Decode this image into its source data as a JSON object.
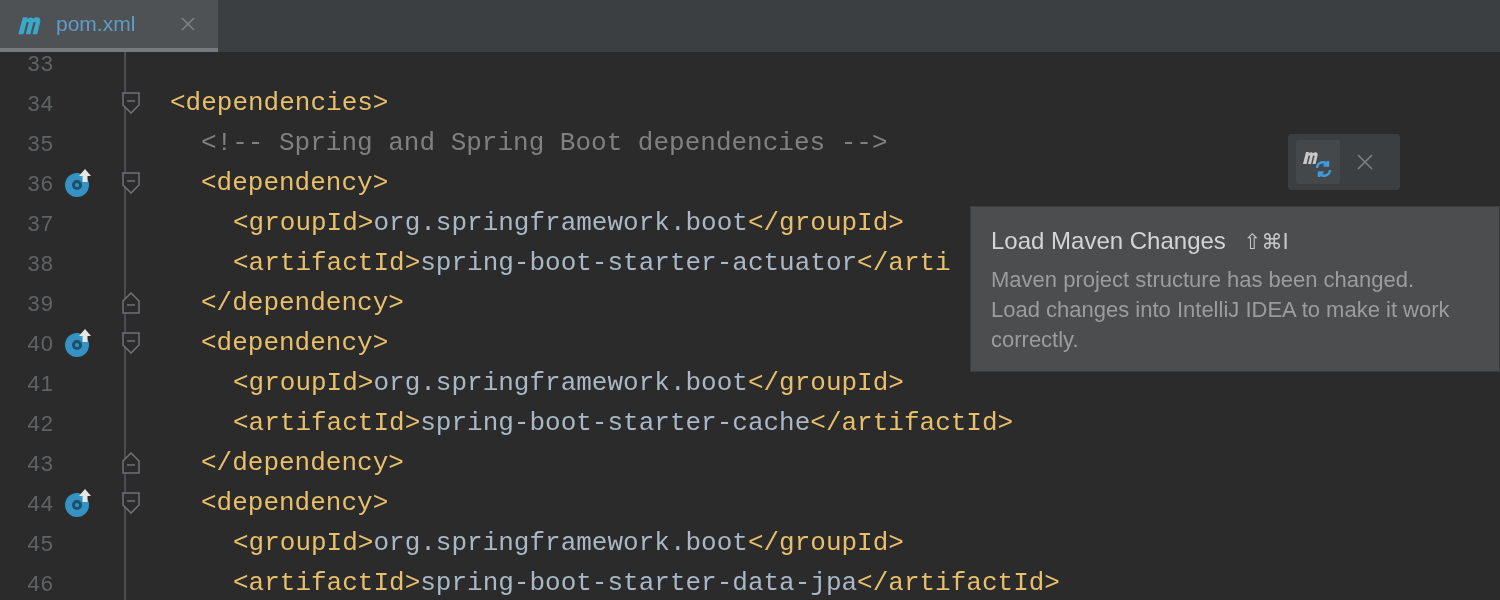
{
  "tab": {
    "title": "pom.xml",
    "selected": true
  },
  "lines": [
    {
      "number": "33",
      "gutter_icon": false
    },
    {
      "number": "34",
      "kind": "fold_start",
      "tokens": [
        {
          "kind": "tag",
          "text": "<dependencies>"
        }
      ],
      "gutter_icon": false,
      "children": [
        {
          "number": "35",
          "tokens": [
            {
              "kind": "comment",
              "text": "<!-- Spring and Spring Boot dependencies -->"
            }
          ],
          "gutter_icon": false
        },
        {
          "number": "36",
          "kind": "fold_start",
          "tokens": [
            {
              "kind": "tag",
              "text": "<dependency>"
            }
          ],
          "gutter_icon": true,
          "children": [
            {
              "number": "37",
              "tokens": [
                {
                  "kind": "tag",
                  "text": "<groupId>"
                },
                {
                  "kind": "text",
                  "text": "org.springframework.boot"
                },
                {
                  "kind": "tag",
                  "text": "</groupId>"
                }
              ],
              "gutter_icon": false
            },
            {
              "number": "38",
              "tokens": [
                {
                  "kind": "tag",
                  "text": "<artifactId>"
                },
                {
                  "kind": "text",
                  "text": "spring-boot-starter-actuator"
                },
                {
                  "kind": "tag",
                  "text": "</arti"
                }
              ],
              "gutter_icon": false
            }
          ]
        },
        {
          "number": "39",
          "kind": "fold_end",
          "tokens": [
            {
              "kind": "tag",
              "text": "</dependency>"
            }
          ],
          "gutter_icon": false
        },
        {
          "number": "40",
          "kind": "fold_start",
          "tokens": [
            {
              "kind": "tag",
              "text": "<dependency>"
            }
          ],
          "gutter_icon": true,
          "children": [
            {
              "number": "41",
              "tokens": [
                {
                  "kind": "tag",
                  "text": "<groupId>"
                },
                {
                  "kind": "text",
                  "text": "org.springframework.boot"
                },
                {
                  "kind": "tag",
                  "text": "</groupId>"
                }
              ],
              "gutter_icon": false
            },
            {
              "number": "42",
              "tokens": [
                {
                  "kind": "tag",
                  "text": "<artifactId>"
                },
                {
                  "kind": "text",
                  "text": "spring-boot-starter-cache"
                },
                {
                  "kind": "tag",
                  "text": "</artifactId>"
                }
              ],
              "gutter_icon": false
            }
          ]
        },
        {
          "number": "43",
          "kind": "fold_end",
          "tokens": [
            {
              "kind": "tag",
              "text": "</dependency>"
            }
          ],
          "gutter_icon": false
        },
        {
          "number": "44",
          "kind": "fold_start",
          "tokens": [
            {
              "kind": "tag",
              "text": "<dependency>"
            }
          ],
          "gutter_icon": true,
          "children": [
            {
              "number": "45",
              "tokens": [
                {
                  "kind": "tag",
                  "text": "<groupId>"
                },
                {
                  "kind": "text",
                  "text": "org.springframework.boot"
                },
                {
                  "kind": "tag",
                  "text": "</groupId>"
                }
              ],
              "gutter_icon": false
            },
            {
              "number": "46",
              "tokens": [
                {
                  "kind": "tag",
                  "text": "<artifactId>"
                },
                {
                  "kind": "text",
                  "text": "spring-boot-starter-data-jpa"
                },
                {
                  "kind": "tag",
                  "text": "</artifactId>"
                }
              ],
              "gutter_icon": false
            }
          ]
        }
      ]
    }
  ],
  "tooltip": {
    "title": "Load Maven Changes",
    "shortcut": "⇧⌘I",
    "description": "Maven project structure has been changed. Load changes into IntelliJ IDEA to make it work correctly."
  }
}
